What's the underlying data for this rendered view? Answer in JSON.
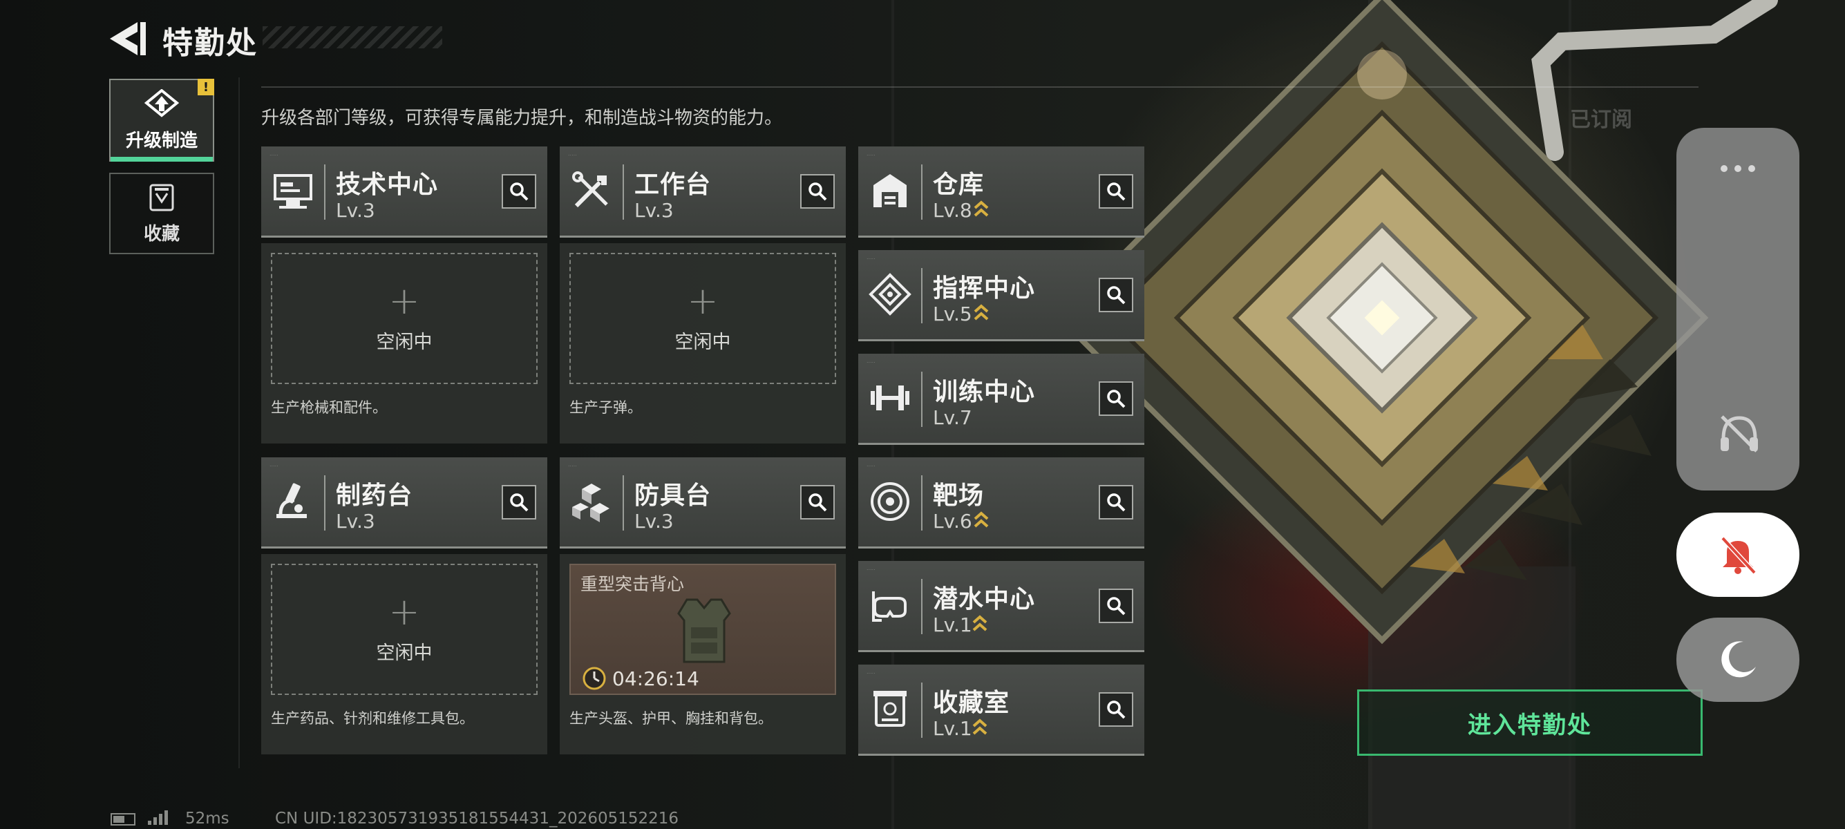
{
  "header": {
    "title": "特勤处"
  },
  "sidebar": {
    "items": [
      {
        "label": "升级制造",
        "active": true,
        "badge": "!"
      },
      {
        "label": "收藏",
        "active": false
      }
    ]
  },
  "description": "升级各部门等级，可获得专属能力提升，和制造战斗物资的能力。",
  "production_cards": [
    {
      "name": "技术中心",
      "level": "Lv.3",
      "slot_plus": "+",
      "slot_status": "空闲中",
      "note": "生产枪械和配件。"
    },
    {
      "name": "工作台",
      "level": "Lv.3",
      "slot_plus": "+",
      "slot_status": "空闲中",
      "note": "生产子弹。"
    },
    {
      "name": "制药台",
      "level": "Lv.3",
      "slot_plus": "+",
      "slot_status": "空闲中",
      "note": "生产药品、针剂和维修工具包。"
    },
    {
      "name": "防具台",
      "level": "Lv.3",
      "crafting_item": "重型突击背心",
      "timer": "04:26:14",
      "note": "生产头盔、护甲、胸挂和背包。"
    }
  ],
  "facilities": [
    {
      "name": "仓库",
      "level": "Lv.8",
      "upgradable": true,
      "icon": "warehouse-icon"
    },
    {
      "name": "指挥中心",
      "level": "Lv.5",
      "upgradable": true,
      "icon": "command-icon"
    },
    {
      "name": "训练中心",
      "level": "Lv.7",
      "upgradable": false,
      "icon": "dumbbell-icon"
    },
    {
      "name": "靶场",
      "level": "Lv.6",
      "upgradable": true,
      "icon": "target-icon"
    },
    {
      "name": "潜水中心",
      "level": "Lv.1",
      "upgradable": true,
      "icon": "dive-mask-icon"
    },
    {
      "name": "收藏室",
      "level": "Lv.1",
      "upgradable": true,
      "icon": "collection-icon"
    }
  ],
  "right_panel": {
    "subscribe_label": "已订阅",
    "enter_button": "进入特勤处"
  },
  "status_bar": {
    "ping": "52ms",
    "uid": "CN UID:182305731935181554431_202605152216"
  },
  "colors": {
    "accent_green": "#53d49a",
    "enter_green": "#5fe59a",
    "upgrade_chevron": "#d8b040",
    "badge_yellow": "#e8c13a",
    "alert_red": "#e0483c"
  }
}
